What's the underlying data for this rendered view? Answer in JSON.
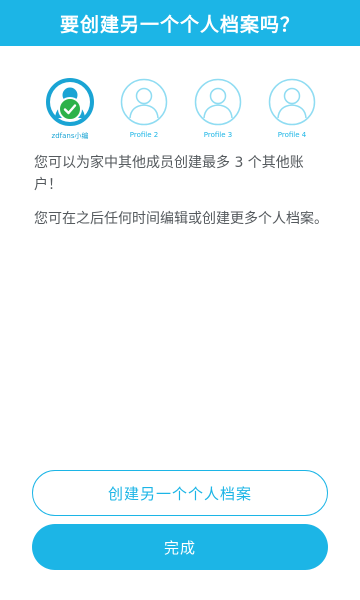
{
  "header": {
    "title": "要创建另一个个人档案吗？"
  },
  "profiles": [
    {
      "label": "zdfans小编",
      "active": true,
      "icon": "avatar-check-icon"
    },
    {
      "label": "Profile 2",
      "active": false,
      "icon": "avatar-placeholder-icon"
    },
    {
      "label": "Profile 3",
      "active": false,
      "icon": "avatar-placeholder-icon"
    },
    {
      "label": "Profile 4",
      "active": false,
      "icon": "avatar-placeholder-icon"
    }
  ],
  "messages": {
    "line1": "您可以为家中其他成员创建最多 3 个其他账户！",
    "line2": "您可在之后任何时间编辑或创建更多个人档案。"
  },
  "buttons": {
    "create_label": "创建另一个个人档案",
    "done_label": "完成"
  },
  "colors": {
    "accent": "#1cb5e6",
    "check": "#2db24a",
    "text": "#555a5e"
  }
}
